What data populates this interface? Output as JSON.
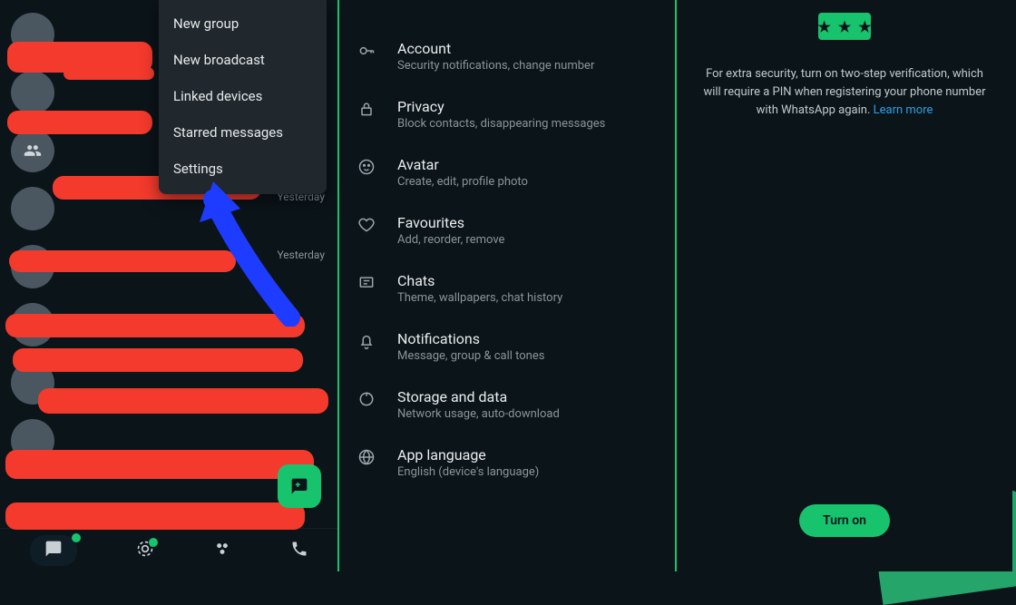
{
  "chatlist": {
    "items": [
      {
        "title": "",
        "sub": "",
        "time": ""
      },
      {
        "title": "",
        "sub": "",
        "time": ""
      },
      {
        "title": "",
        "sub": "",
        "time": ""
      },
      {
        "title": "",
        "sub": "",
        "time": "Yesterday"
      },
      {
        "title": "",
        "sub": "",
        "time": "Yesterday"
      },
      {
        "title": "",
        "sub": "",
        "time": ""
      },
      {
        "title": "",
        "sub": "",
        "time": ""
      },
      {
        "title": "",
        "sub": "",
        "time": ""
      }
    ]
  },
  "menu": {
    "items": [
      "New group",
      "New broadcast",
      "Linked devices",
      "Starred messages",
      "Settings"
    ]
  },
  "settings": {
    "items": [
      {
        "title": "Account",
        "sub": "Security notifications, change number"
      },
      {
        "title": "Privacy",
        "sub": "Block contacts, disappearing messages"
      },
      {
        "title": "Avatar",
        "sub": "Create, edit, profile photo"
      },
      {
        "title": "Favourites",
        "sub": "Add, reorder, remove"
      },
      {
        "title": "Chats",
        "sub": "Theme, wallpapers, chat history"
      },
      {
        "title": "Notifications",
        "sub": "Message, group & call tones"
      },
      {
        "title": "Storage and data",
        "sub": "Network usage, auto-download"
      },
      {
        "title": "App language",
        "sub": "English (device's language)"
      }
    ]
  },
  "twostep": {
    "pin_glyph": "★",
    "desc_pre": "For extra security, turn on two-step verification, which will require a PIN when registering your phone number with WhatsApp again. ",
    "learn_more": "Learn more",
    "button": "Turn on"
  }
}
